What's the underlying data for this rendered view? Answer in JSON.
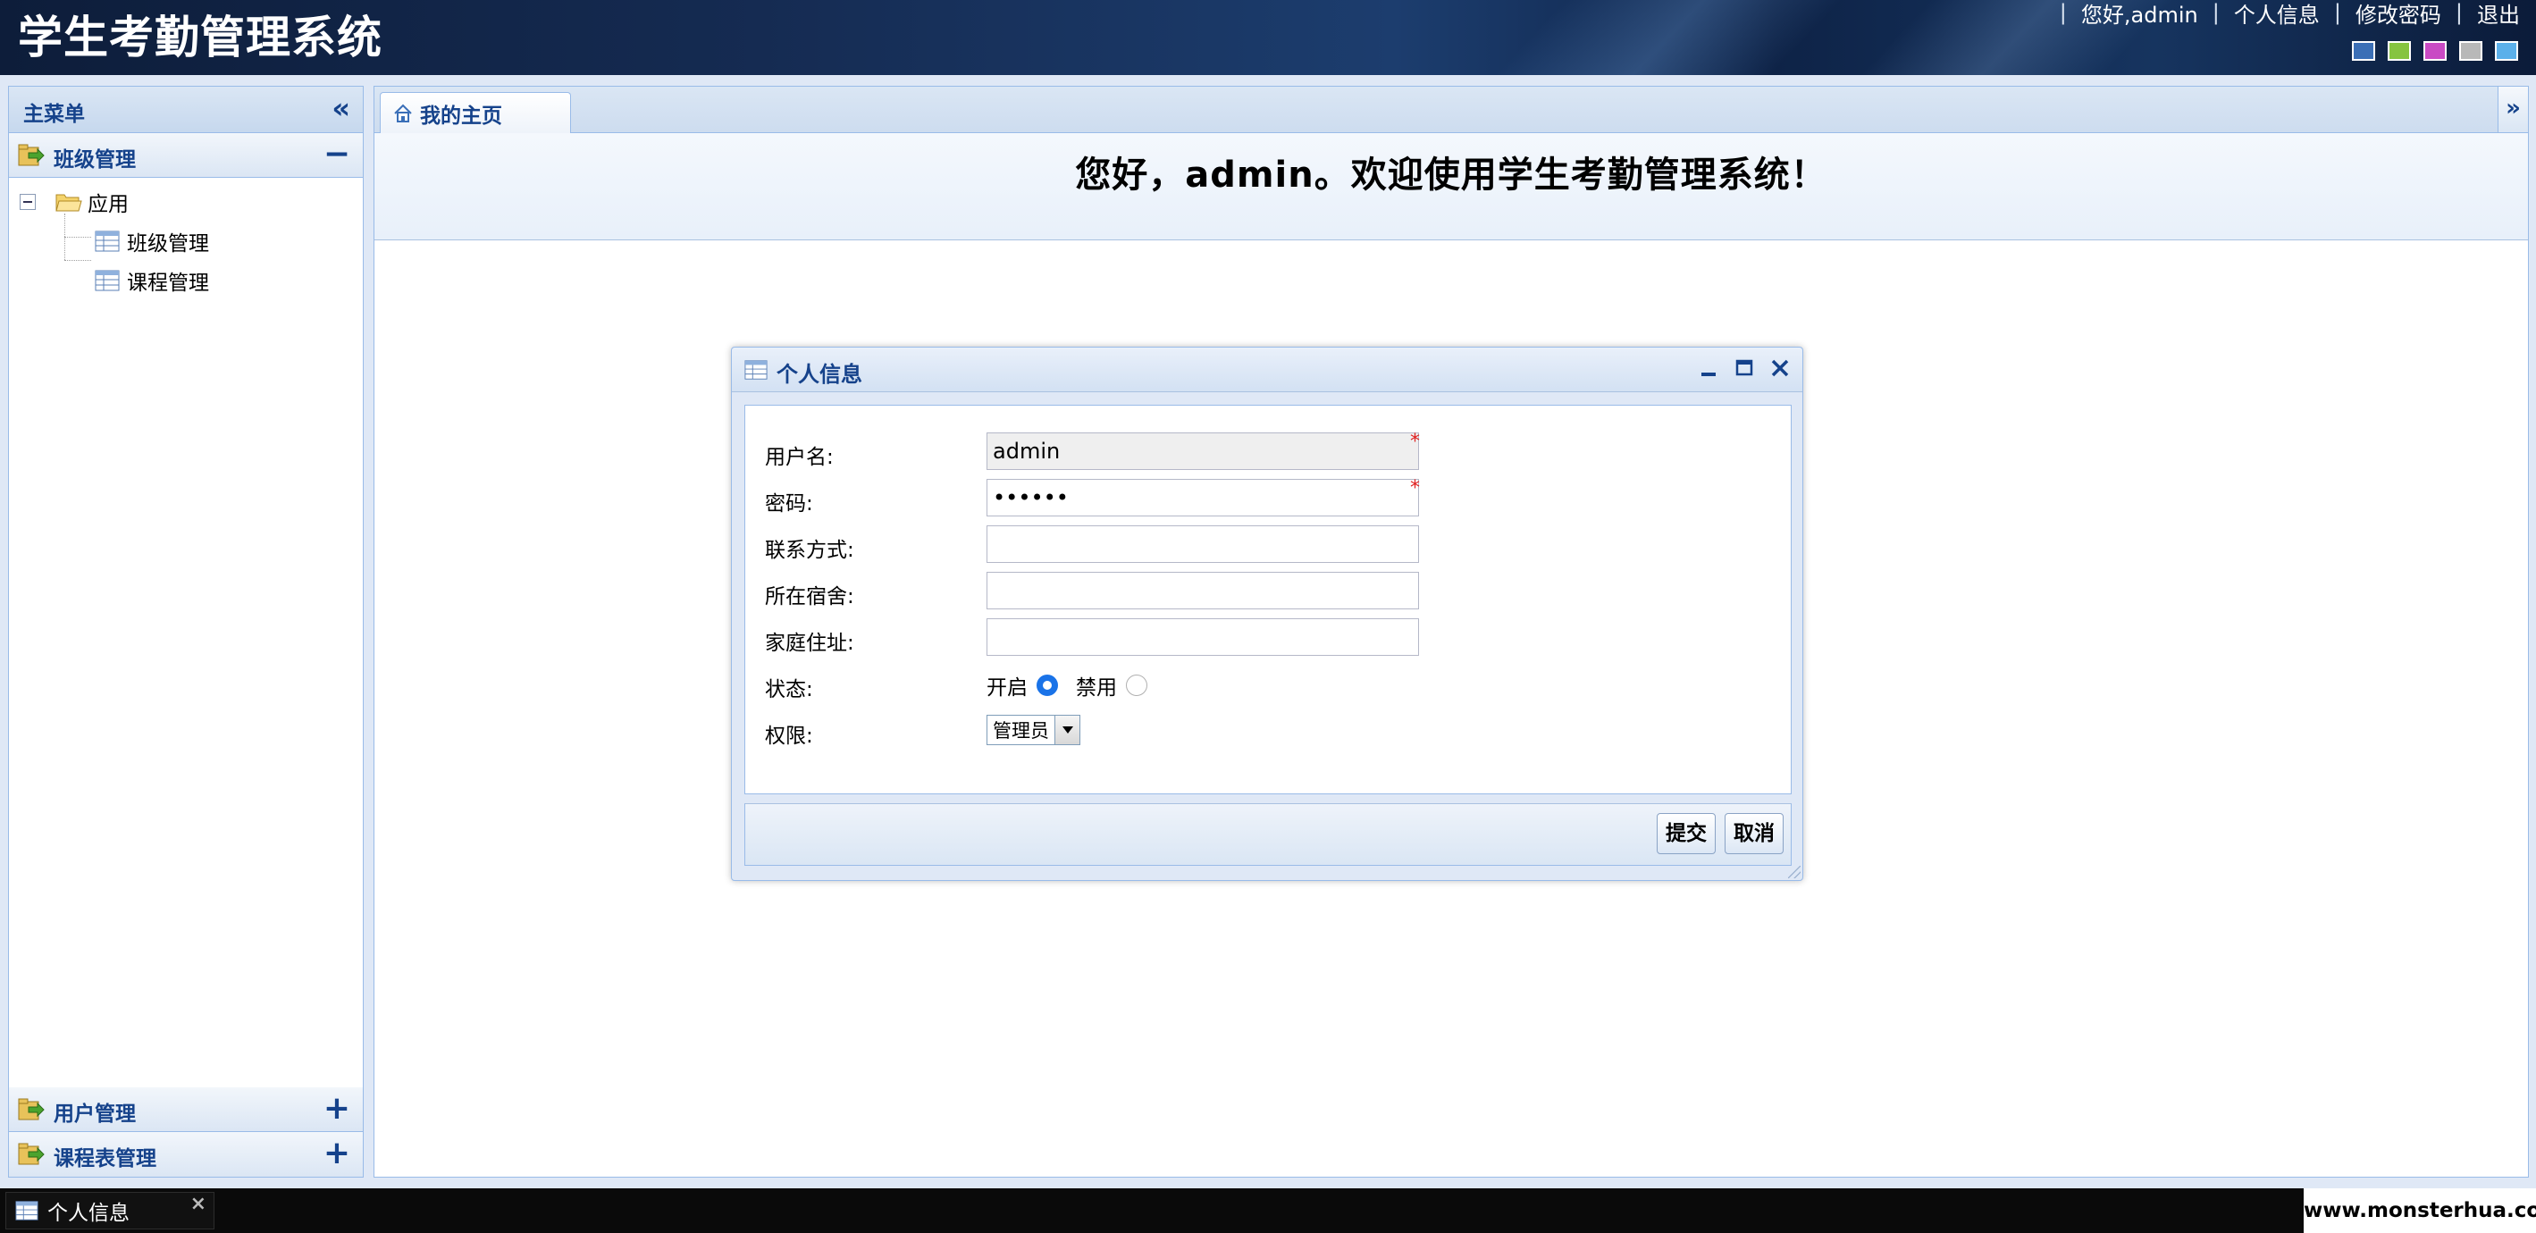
{
  "app": {
    "title": "学生考勤管理系统",
    "greeting": "您好,admin",
    "links": [
      "个人信息",
      "修改密码",
      "退出"
    ],
    "theme_colors": [
      "#3b6fb6",
      "#86c440",
      "#c94ac4",
      "#b8b8b8",
      "#5bb0ea"
    ]
  },
  "sidebar": {
    "title": "主菜单",
    "collapse_icon": "double-chevron-left-icon",
    "panels": [
      {
        "label": "班级管理",
        "expanded": true,
        "toggle": "−"
      },
      {
        "label": "用户管理",
        "expanded": false,
        "toggle": "+"
      },
      {
        "label": "课程表管理",
        "expanded": false,
        "toggle": "+"
      }
    ],
    "tree": {
      "root": "应用",
      "children": [
        "班级管理",
        "课程管理"
      ]
    }
  },
  "main": {
    "tab": "我的主页",
    "welcome": "您好，admin。欢迎使用学生考勤管理系统！"
  },
  "dialog": {
    "title": "个人信息",
    "fields": [
      {
        "label": "用户名:",
        "value": "admin",
        "required": true,
        "readonly": true
      },
      {
        "label": "密码:",
        "value": "••••••",
        "required": true
      },
      {
        "label": "联系方式:",
        "value": ""
      },
      {
        "label": "所在宿舍:",
        "value": ""
      },
      {
        "label": "家庭住址:",
        "value": ""
      }
    ],
    "status": {
      "label": "状态:",
      "options": [
        "开启",
        "禁用"
      ],
      "selected": "开启"
    },
    "role": {
      "label": "权限:",
      "value": "管理员"
    },
    "buttons": {
      "submit": "提交",
      "cancel": "取消"
    },
    "required_mark": "*"
  },
  "taskbar": {
    "item": "个人信息",
    "close": "×"
  },
  "watermark": "www.monsterhua.com"
}
